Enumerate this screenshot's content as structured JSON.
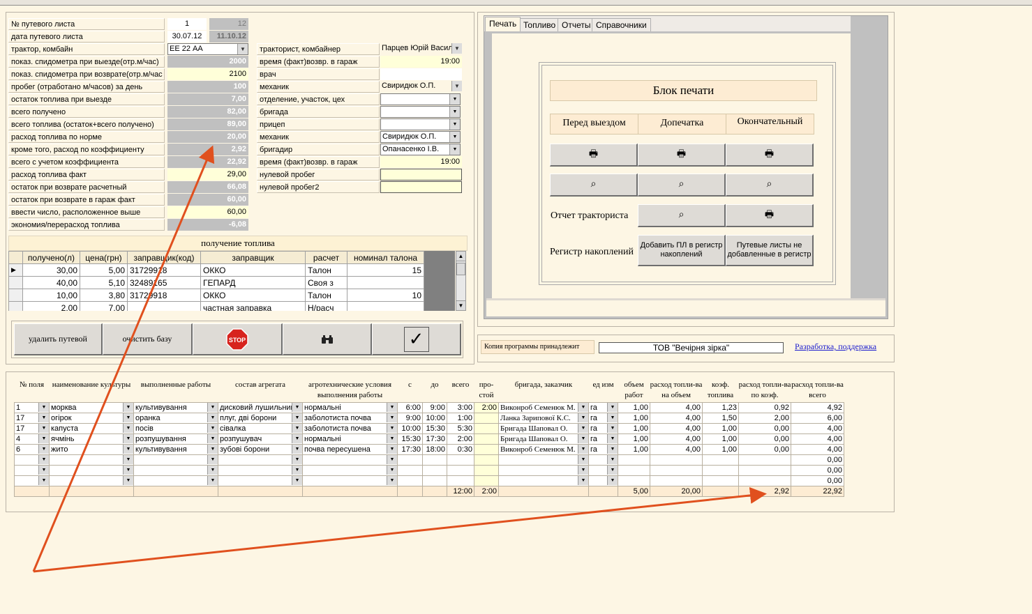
{
  "waybill": {
    "fields": [
      {
        "label": "№ путевого листа",
        "value": "1",
        "value2": "12"
      },
      {
        "label": "дата путевого листа",
        "value": "30.07.12",
        "value2": "11.10.12"
      },
      {
        "label": "трактор, комбайн",
        "value": "ЕЕ 22 АА"
      },
      {
        "label": "показ. спидометра при выезде(отр.м/час)",
        "value": "2000"
      },
      {
        "label": "показ. спидометра при возврате(отр.м/час",
        "value": "2100"
      },
      {
        "label": "пробег (отработано м/часов) за день",
        "value": "100"
      },
      {
        "label": "остаток топлива при выезде",
        "value": "7,00"
      },
      {
        "label": "всего получено",
        "value": "82,00"
      },
      {
        "label": "всего топлива (остаток+всего получено)",
        "value": "89,00"
      },
      {
        "label": "расход топлива по норме",
        "value": "20,00"
      },
      {
        "label": "кроме того, расход по коэффициенту",
        "value": "2,92"
      },
      {
        "label": "всего с учетом коэффициента",
        "value": "22,92"
      },
      {
        "label": "расход топлива факт",
        "value": "29,00"
      },
      {
        "label": "остаток при возврате расчетный",
        "value": "66,08"
      },
      {
        "label": "остаток при возврате в гараж  факт",
        "value": "60,00"
      },
      {
        "label": "ввести число, расположенное выше",
        "value": "60,00"
      },
      {
        "label": "экономия/перерасход топлива",
        "value": "-6,08"
      }
    ],
    "right_fields": [
      {
        "label": "тракторист, комбайнер",
        "value": "Парцев Юрій Василь"
      },
      {
        "label": "время (факт)возвр. в гараж",
        "value": "19:00"
      },
      {
        "label": "врач",
        "value": ""
      },
      {
        "label": "механик",
        "value": "Свиридюк О.П."
      },
      {
        "label": "отделение, участок, цех",
        "value": ""
      },
      {
        "label": "бригада",
        "value": ""
      },
      {
        "label": "прицеп",
        "value": ""
      },
      {
        "label": "механик",
        "value": "Свиридюк О.П."
      },
      {
        "label": "бригадир",
        "value": "Опанасенко І.В."
      },
      {
        "label": "время (факт)возвр. в гараж",
        "value": "19:00"
      },
      {
        "label": "нулевой пробег",
        "value": ""
      },
      {
        "label": "нулевой пробег2",
        "value": ""
      }
    ]
  },
  "fuel": {
    "title": "получение топлива",
    "columns": [
      "получено(л)",
      "цена(грн)",
      "заправщик(код)",
      "заправщик",
      "расчет",
      "номинал талона"
    ],
    "rows": [
      [
        "30,00",
        "5,00",
        "31729918",
        "ОККО",
        "Талон",
        "15"
      ],
      [
        "40,00",
        "5,10",
        "32489165",
        "ГЕПАРД",
        "Своя з",
        ""
      ],
      [
        "10,00",
        "3,80",
        "31729918",
        "ОККО",
        "Талон",
        "10"
      ],
      [
        "2,00",
        "7,00",
        "",
        "частная заправка",
        "Н/расч",
        ""
      ]
    ]
  },
  "actions": {
    "delete_label": "удалить путевой",
    "clear_label": "очистить базу",
    "stop_label": "STOP"
  },
  "tabs": [
    "Печать",
    "Топливо",
    "Отчеты",
    "Справочники"
  ],
  "print_block": {
    "title": "Блок печати",
    "col1": "Перед выездом",
    "col2": "Допечатка",
    "col3": "Окончательный",
    "driver_report": "Отчет тракториста",
    "register": "Регистр накоплений",
    "add_to_register": "Добавить ПЛ в регистр накоплений",
    "not_added": "Путевые листы не добавленные в регистр"
  },
  "owner": {
    "label": "Копия программы принадлежит",
    "name": "ТОВ \"Вечірня зірка\"",
    "support_link": "Разработка, поддержка"
  },
  "works": {
    "headers": [
      "№ поля",
      "наименование культуры",
      "выполненные работы",
      "состав агрегата",
      "агротехнические условия выполнения работы",
      "с",
      "до",
      "всего",
      "про-стой",
      "бригада, заказчик",
      "ед изм",
      "объем работ",
      "расход топли-ва на объем",
      "коэф. топлива",
      "расход топли-ва по коэф.",
      "расход топли-ва всего"
    ],
    "rows": [
      [
        "1",
        "морква",
        "культивування",
        "дисковий лушильник",
        "нормальні",
        "6:00",
        "9:00",
        "3:00",
        "2:00",
        "Виконроб Семенюк М.",
        "га",
        "1,00",
        "4,00",
        "1,23",
        "0,92",
        "4,92"
      ],
      [
        "17",
        "огірок",
        "оранка",
        "плуг, дві борони",
        "заболотиста почва",
        "9:00",
        "10:00",
        "1:00",
        "",
        "Ланка Зарипової К.С.",
        "га",
        "1,00",
        "4,00",
        "1,50",
        "2,00",
        "6,00"
      ],
      [
        "17",
        "капуста",
        "посів",
        "сівалка",
        "заболотиста почва",
        "10:00",
        "15:30",
        "5:30",
        "",
        "Бригада Шаповал О.",
        "га",
        "1,00",
        "4,00",
        "1,00",
        "0,00",
        "4,00"
      ],
      [
        "4",
        "ячмінь",
        "розпушування",
        "розпушувач",
        "нормальні",
        "15:30",
        "17:30",
        "2:00",
        "",
        "Бригада Шаповал О.",
        "га",
        "1,00",
        "4,00",
        "1,00",
        "0,00",
        "4,00"
      ],
      [
        "6",
        "жито",
        "культивування",
        "зубові борони",
        "почва пересушена",
        "17:30",
        "18:00",
        "0:30",
        "",
        "Виконроб Семенюк М.",
        "га",
        "1,00",
        "4,00",
        "1,00",
        "0,00",
        "4,00"
      ],
      [
        "",
        "",
        "",
        "",
        "",
        "",
        "",
        "",
        "",
        "",
        "",
        "",
        "",
        "",
        "",
        "0,00"
      ],
      [
        "",
        "",
        "",
        "",
        "",
        "",
        "",
        "",
        "",
        "",
        "",
        "",
        "",
        "",
        "",
        "0,00"
      ],
      [
        "",
        "",
        "",
        "",
        "",
        "",
        "",
        "",
        "",
        "",
        "",
        "",
        "",
        "",
        "",
        "0,00"
      ]
    ],
    "totals": {
      "total": "12:00",
      "idle": "2:00",
      "volume": "5,00",
      "fuel_volume": "20,00",
      "fuel_coef": "2,92",
      "fuel_total": "22,92"
    }
  },
  "colors": {
    "arrow": "#e0501e",
    "background": "#fdf6e4",
    "link": "#1a1acd"
  }
}
